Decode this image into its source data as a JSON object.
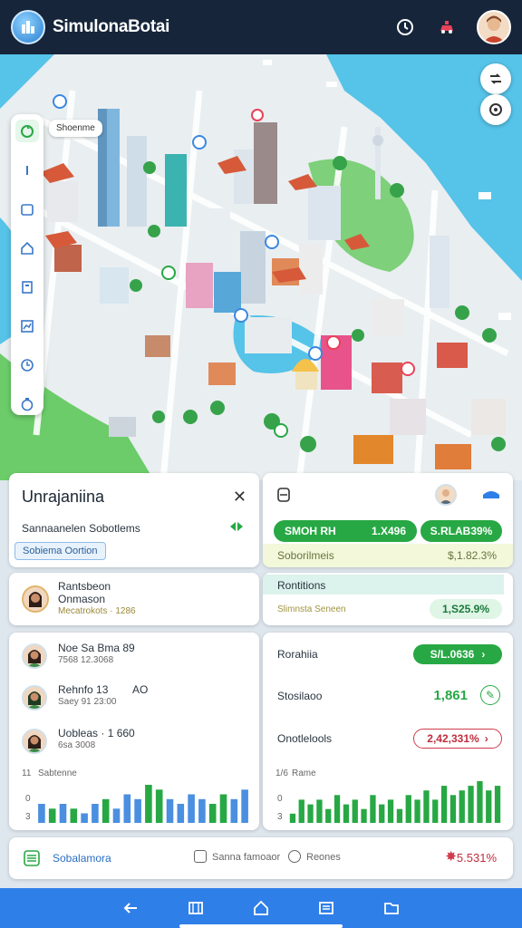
{
  "app": {
    "title": "SimulonaBotai"
  },
  "map": {
    "tag_label": "Shoenme"
  },
  "panel_left_top": {
    "title": "Unrajaniina",
    "subtitle": "Sannaanelen Sobotlems",
    "chip": "Sobiema Oortion"
  },
  "panel_right_top": {
    "pill_left": {
      "label": "SMOH RH",
      "value": "1.X496"
    },
    "pill_right": "S.RLAB39%",
    "row_label": "Soborilmeis",
    "row_value": "$,1.82.3%"
  },
  "panel_left_mid": {
    "name": "Rantsbeon",
    "line2": "Onmason",
    "line3": "Mecatrokots · 1286"
  },
  "panel_right_mid": {
    "title": "Rontitions",
    "sub": "Slimnsta Seneen",
    "value": "1,S25.9%"
  },
  "people": [
    {
      "name": "Noe Sa Bma 89",
      "sub": "7568 12.3068"
    },
    {
      "name": "Rehnfo 13",
      "aside": "AO",
      "sub": "Saey 91 23:00"
    },
    {
      "name": "Uobleas · 1 660",
      "sub": "6sa 3008"
    }
  ],
  "left_chart": {
    "title": "Sabtenne",
    "y_ticks": [
      "11",
      "0",
      "3"
    ],
    "type": "bar",
    "values": [
      4,
      3,
      4,
      3,
      2,
      4,
      5,
      3,
      6,
      5,
      8,
      7,
      5,
      4,
      6,
      5,
      4,
      6,
      5,
      7
    ]
  },
  "stats": [
    {
      "label": "Rorahiia",
      "value": "S/L.0636"
    },
    {
      "label": "Stosilaoo",
      "value": "1,861"
    },
    {
      "label": "Onotlelools",
      "value": "2,42,331%"
    }
  ],
  "right_chart": {
    "title": "Rame",
    "y_ticks": [
      "1/6",
      "0",
      "3"
    ],
    "type": "bar",
    "values": [
      2,
      5,
      4,
      5,
      3,
      6,
      4,
      5,
      3,
      6,
      4,
      5,
      3,
      6,
      5,
      7,
      5,
      8,
      6,
      7,
      8,
      9,
      7,
      8
    ]
  },
  "footer": {
    "label": "Sobalamora",
    "check1": "Sanna famoaor",
    "check2": "Reones",
    "value": "5.531%"
  },
  "colors": {
    "green": "#27a844",
    "blue": "#4a8fe0",
    "red": "#d03b4b",
    "header": "#16253a",
    "nav": "#2f7fe8"
  }
}
